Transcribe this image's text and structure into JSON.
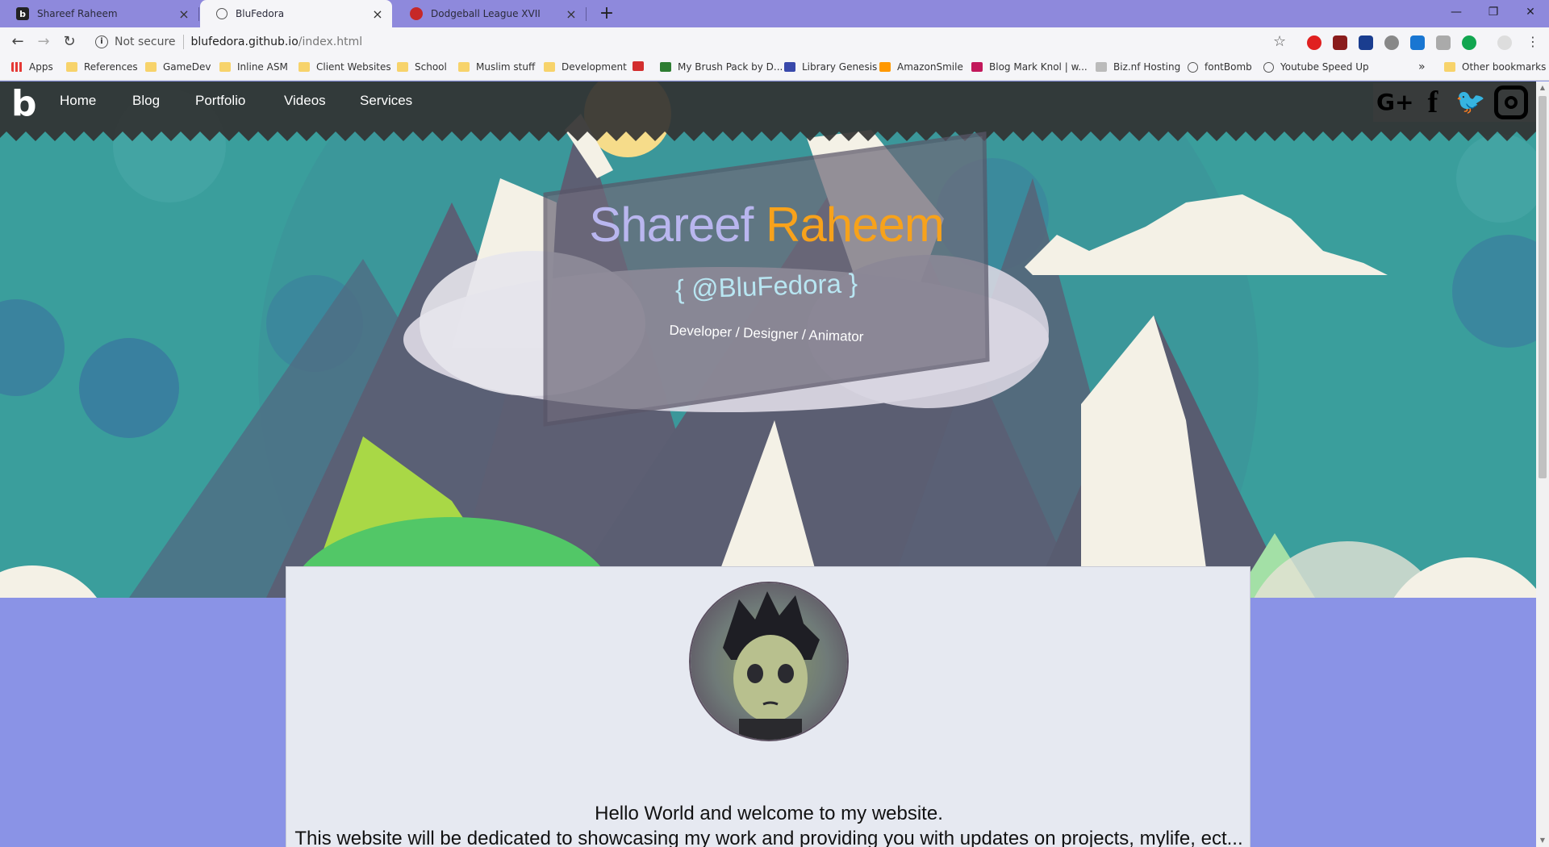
{
  "browser": {
    "tabs": [
      {
        "title": "Shareef Raheem",
        "favicon": "b-logo-icon"
      },
      {
        "title": "BluFedora",
        "favicon": "globe-icon"
      },
      {
        "title": "Dodgeball League XVII",
        "favicon": "red-game-icon"
      }
    ],
    "new_tab": "+",
    "window_controls": {
      "minimize": "—",
      "restore": "❐",
      "close": "✕"
    },
    "toolbar": {
      "back": "←",
      "forward": "→",
      "reload": "↻",
      "security": "Not secure",
      "url_host": "blufedora.github.io",
      "url_path": "/index.html",
      "bookmark_star": "☆"
    },
    "bookmarks": [
      {
        "label": "Apps",
        "icon": "apps-grid-icon"
      },
      {
        "label": "References",
        "icon": "folder-icon"
      },
      {
        "label": "GameDev",
        "icon": "folder-icon"
      },
      {
        "label": "Inline ASM",
        "icon": "folder-icon"
      },
      {
        "label": "Client Websites",
        "icon": "folder-icon"
      },
      {
        "label": "School",
        "icon": "folder-icon"
      },
      {
        "label": "Muslim stuff",
        "icon": "folder-icon"
      },
      {
        "label": "Development",
        "icon": "folder-icon"
      },
      {
        "label": "",
        "icon": "adobe-icon"
      },
      {
        "label": "My Brush Pack by D...",
        "icon": "brush-icon"
      },
      {
        "label": "Library Genesis",
        "icon": "library-icon"
      },
      {
        "label": "AmazonSmile",
        "icon": "amazon-icon"
      },
      {
        "label": "Blog Mark Knol | w...",
        "icon": "heart-icon"
      },
      {
        "label": "Biz.nf Hosting",
        "icon": "hosting-icon"
      },
      {
        "label": "fontBomb",
        "icon": "globe-icon"
      },
      {
        "label": "Youtube Speed Up",
        "icon": "globe-icon"
      }
    ],
    "bookmarks_more": "»",
    "other_bookmarks": "Other bookmarks"
  },
  "site": {
    "logo": "b",
    "nav": [
      "Home",
      "Blog",
      "Portfolio",
      "Videos",
      "Services"
    ],
    "social": {
      "google_plus": "G+",
      "facebook": "f",
      "twitter": "🐦",
      "instagram": "◎"
    },
    "hero": {
      "first_name": "Shareef",
      "last_name": "Raheem",
      "handle": "{ @BluFedora }",
      "roles": "Developer / Designer / Animator"
    },
    "welcome_line1": "Hello World and welcome to my website.",
    "welcome_line2": "This website will be dedicated to showcasing my work and providing you with updates on projects, mylife, ect..."
  },
  "colors": {
    "tab_bar": "#8e89dc",
    "page_background": "#8a93e6",
    "hero_teal": "#3a9e9c",
    "accent_orange": "#f7a21b",
    "name_lavender": "#b9b6ef"
  }
}
